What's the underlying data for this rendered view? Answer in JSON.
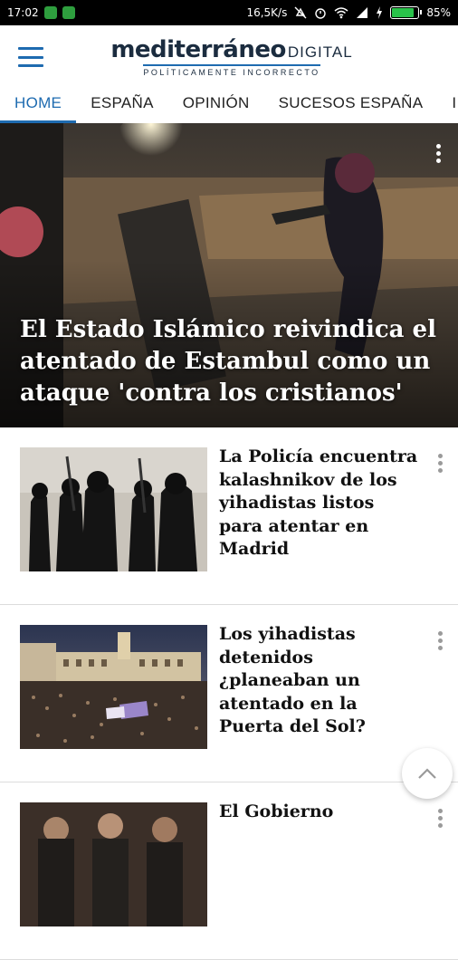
{
  "status_bar": {
    "time": "17:02",
    "network_speed": "16,5K/s",
    "battery_percent": "85%",
    "battery_level": 0.85
  },
  "header": {
    "logo_main": "mediterráneo",
    "logo_digital": "DIGITAL",
    "logo_tagline": "POLÍTICAMENTE INCORRECTO",
    "menu_icon": "hamburger-menu-icon"
  },
  "tabs": [
    {
      "label": "HOME",
      "active": true
    },
    {
      "label": "ESPAÑA",
      "active": false
    },
    {
      "label": "OPINIÓN",
      "active": false
    },
    {
      "label": "SUCESOS ESPAÑA",
      "active": false
    },
    {
      "label": "I",
      "active": false
    }
  ],
  "hero": {
    "title": "El Estado Islámico reivindica el atentado de Estambul como un ataque 'contra los cristianos'"
  },
  "articles": [
    {
      "headline": "La Policía encuentra kalashnikov de los yihadistas listos para atentar en Madrid"
    },
    {
      "headline": "Los yihadistas detenidos ¿planeaban un atentado en la Puerta del Sol?"
    },
    {
      "headline": "El Gobierno"
    }
  ],
  "colors": {
    "accent": "#1e6bb0",
    "brand_dark": "#1b2c3f"
  }
}
